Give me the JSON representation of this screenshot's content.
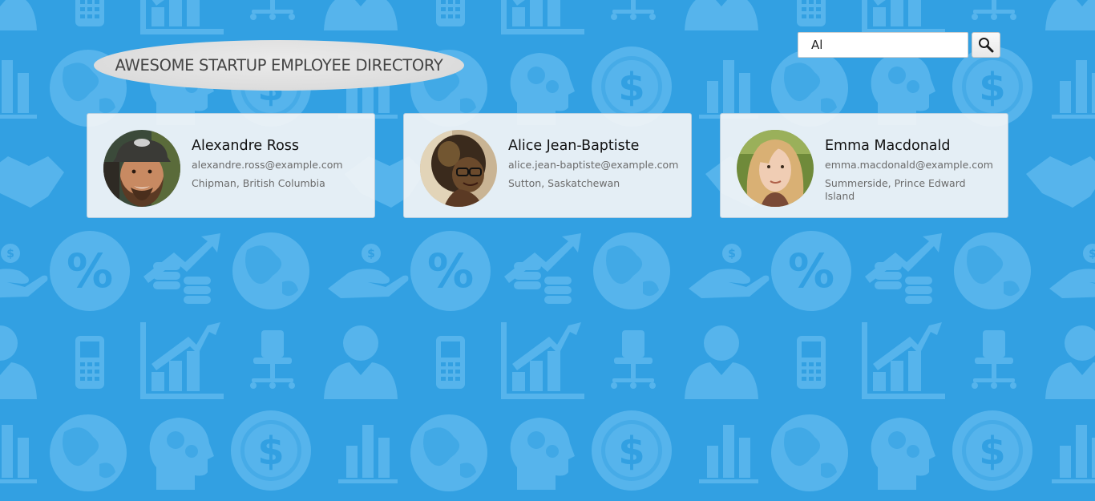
{
  "header": {
    "title": "AWESOME STARTUP EMPLOYEE DIRECTORY"
  },
  "search": {
    "value": "Al",
    "button_icon": "search-icon"
  },
  "background": {
    "color": "#32a0e2",
    "pattern_color": "#56b4ec",
    "pattern_icons": [
      "phone-icon",
      "bar-chart-icon",
      "office-chair-icon",
      "businessman-icon",
      "globe-icon",
      "gears-head-icon",
      "dollar-coin-icon",
      "percent-icon",
      "coins-growth-icon",
      "money-hand-icon",
      "handshake-icon"
    ]
  },
  "employees": [
    {
      "name": "Alexandre Ross",
      "email": "alexandre.ross@example.com",
      "location": "Chipman, British Columbia",
      "avatar": "avatar-photo-bearded-man-cap"
    },
    {
      "name": "Alice Jean-Baptiste",
      "email": "alice.jean-baptiste@example.com",
      "location": "Sutton, Saskatchewan",
      "avatar": "avatar-photo-woman-glasses"
    },
    {
      "name": "Emma Macdonald",
      "email": "emma.macdonald@example.com",
      "location": "Summerside, Prince Edward Island",
      "avatar": "avatar-photo-blonde-woman"
    }
  ]
}
